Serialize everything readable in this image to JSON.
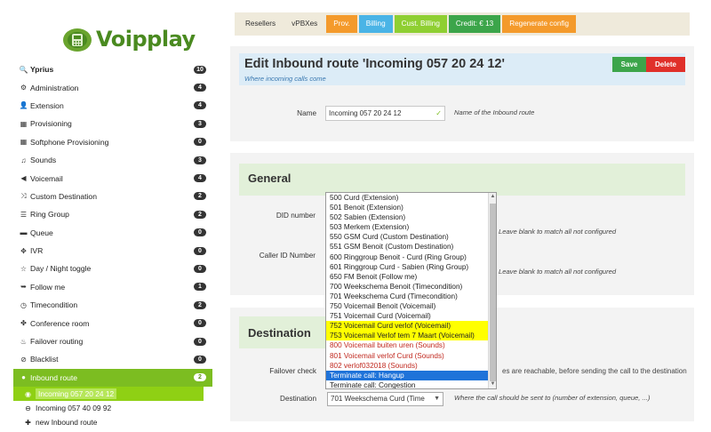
{
  "brand": {
    "name": "Voipplay",
    "color": "#4a8a20"
  },
  "sidebar": {
    "items": [
      {
        "label": "Yprius",
        "badge": "10",
        "icon": "search-icon",
        "glyph": "🔍",
        "bold": true
      },
      {
        "label": "Administration",
        "badge": "4",
        "icon": "gear-icon",
        "glyph": "⚙"
      },
      {
        "label": "Extension",
        "badge": "4",
        "icon": "user-icon",
        "glyph": "👤"
      },
      {
        "label": "Provisioning",
        "badge": "3",
        "icon": "grid-icon",
        "glyph": "▦"
      },
      {
        "label": "Softphone Provisioning",
        "badge": "0",
        "icon": "grid-icon",
        "glyph": "▦"
      },
      {
        "label": "Sounds",
        "badge": "3",
        "icon": "music-icon",
        "glyph": "♫"
      },
      {
        "label": "Voicemail",
        "badge": "4",
        "icon": "speaker-icon",
        "glyph": "◀"
      },
      {
        "label": "Custom Destination",
        "badge": "2",
        "icon": "shuffle-icon",
        "glyph": "⤨"
      },
      {
        "label": "Ring Group",
        "badge": "2",
        "icon": "list-icon",
        "glyph": "☰"
      },
      {
        "label": "Queue",
        "badge": "0",
        "icon": "queue-icon",
        "glyph": "▬"
      },
      {
        "label": "IVR",
        "badge": "0",
        "icon": "ivr-icon",
        "glyph": "✥"
      },
      {
        "label": "Day / Night toggle",
        "badge": "0",
        "icon": "star-icon",
        "glyph": "☆"
      },
      {
        "label": "Follow me",
        "badge": "1",
        "icon": "follow-icon",
        "glyph": "➥"
      },
      {
        "label": "Timecondition",
        "badge": "2",
        "icon": "clock-icon",
        "glyph": "◷"
      },
      {
        "label": "Conference room",
        "badge": "0",
        "icon": "conference-icon",
        "glyph": "✤"
      },
      {
        "label": "Failover routing",
        "badge": "0",
        "icon": "flame-icon",
        "glyph": "♨"
      },
      {
        "label": "Blacklist",
        "badge": "0",
        "icon": "blacklist-icon",
        "glyph": "⊘"
      },
      {
        "label": "Inbound route",
        "badge": "2",
        "icon": "circle-icon",
        "glyph": "●",
        "active": true
      }
    ],
    "subitems": [
      {
        "label": "Incoming 057 20 24 12",
        "icon": "radio-selected-icon",
        "glyph": "◉",
        "selected": true
      },
      {
        "label": "Incoming 057 40 09 92",
        "icon": "minus-circle-icon",
        "glyph": "⊖"
      },
      {
        "label": "new Inbound route",
        "icon": "plus-icon",
        "glyph": "✚"
      }
    ]
  },
  "topbar": {
    "buttons": [
      {
        "label": "Resellers",
        "style": "plain"
      },
      {
        "label": "vPBXes",
        "style": "plain"
      },
      {
        "label": "Prov.",
        "style": "orange"
      },
      {
        "label": "Billing",
        "style": "blue"
      },
      {
        "label": "Cust. Billing",
        "style": "lime"
      },
      {
        "label": "Credit: € 13",
        "style": "green"
      },
      {
        "label": "Regenerate config",
        "style": "orange"
      }
    ]
  },
  "edit": {
    "title": "Edit Inbound route 'Incoming 057 20 24 12'",
    "subtitle": "Where incoming calls come",
    "save": "Save",
    "delete": "Delete",
    "name_label": "Name",
    "name_value": "Incoming 057 20 24 12",
    "name_hint": "Name of the Inbound route"
  },
  "general": {
    "title": "General",
    "did_label": "DID number",
    "did_hint": "Leave blank to match all not configured",
    "callerid_label": "Caller ID Number",
    "callerid_hint": "Leave blank to match all not configured"
  },
  "destination": {
    "title": "Destination",
    "failover_label": "Failover check",
    "failover_hint": "es are reachable, before sending the call to the destination",
    "destination_label": "Destination",
    "destination_value": "701 Weekschema Curd (Time",
    "destination_hint": "Where the call should be sent to (number of extension, queue, ...)"
  },
  "dropdown": {
    "options": [
      {
        "label": "500 Curd (Extension)"
      },
      {
        "label": "501 Benoit (Extension)"
      },
      {
        "label": "502 Sabien (Extension)"
      },
      {
        "label": "503 Merkem (Extension)"
      },
      {
        "label": "550 GSM Curd (Custom Destination)"
      },
      {
        "label": "551 GSM Benoit (Custom Destination)"
      },
      {
        "label": "600 Ringgroup Benoit - Curd (Ring Group)"
      },
      {
        "label": "601 Ringgroup Curd - Sabien (Ring Group)"
      },
      {
        "label": "650 FM Benoit (Follow me)"
      },
      {
        "label": "700 Weekschema Benoit (Timecondition)"
      },
      {
        "label": "701 Weekschema Curd (Timecondition)"
      },
      {
        "label": "750 Voicemail Benoit (Voicemail)"
      },
      {
        "label": "751 Voicemail Curd (Voicemail)"
      },
      {
        "label": "752 Voicemail Curd verlof (Voicemail)",
        "style": "yellow"
      },
      {
        "label": "753 Voicemail Verlof tem 7 Maart (Voicemail)",
        "style": "yellow"
      },
      {
        "label": "800 Voicemail buiten uren (Sounds)",
        "style": "red"
      },
      {
        "label": "801 Voicemail verlof Curd (Sounds)",
        "style": "red"
      },
      {
        "label": "802 verlof032018 (Sounds)",
        "style": "red"
      },
      {
        "label": "Terminate call: Hangup",
        "style": "sel"
      },
      {
        "label": "Terminate call: Congestion"
      }
    ]
  }
}
